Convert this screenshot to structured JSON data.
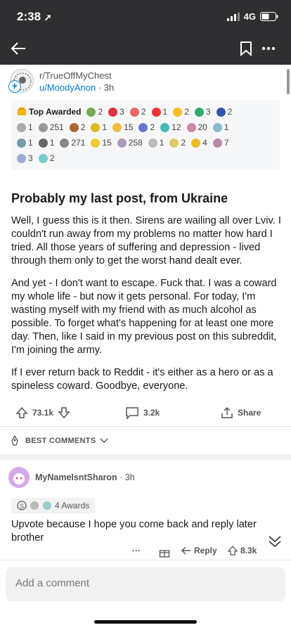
{
  "status": {
    "time": "2:38",
    "network": "4G"
  },
  "post": {
    "subreddit": "r/TrueOffMyChest",
    "author": "u/MoodyAnon",
    "time": "3h",
    "title": "Probably my last post, from Ukraine",
    "paragraphs": [
      "Well, I guess this is it then. Sirens are wailing all over Lviv. I couldn't run away from my problems no matter how hard I tried. All those years of suffering and depression - lived through them only to get the worst hand dealt ever.",
      "And yet - I don't want to escape. Fuck that. I was a coward my whole life - but now it gets personal. For today, I'm wasting myself with my friend with as much alcohol as possible. To forget what's happening for at least one more day. Then, like I said in my previous post on this subreddit, I'm joining the army.",
      "If I ever return back to Reddit - it's either as a hero or as a spineless coward. Goodbye, everyone."
    ],
    "upvotes": "73.1k",
    "comments": "3.2k",
    "share_label": "Share"
  },
  "awards": {
    "top_label": "Top Awarded",
    "rows": [
      [
        {
          "c": "#7a5",
          "n": "2"
        },
        {
          "c": "#d34",
          "n": "3"
        },
        {
          "c": "#e66",
          "n": "2"
        },
        {
          "c": "#e33",
          "n": "1"
        },
        {
          "c": "#fb2",
          "n": "2"
        },
        {
          "c": "#3a6",
          "n": "3"
        },
        {
          "c": "#35a",
          "n": "2"
        }
      ],
      [
        {
          "c": "#aaa",
          "n": "1"
        },
        {
          "c": "#999",
          "n": "251"
        },
        {
          "c": "#a63",
          "n": "2"
        },
        {
          "c": "#db2",
          "n": "1"
        },
        {
          "c": "#eb4",
          "n": "15"
        },
        {
          "c": "#67c",
          "n": "2"
        },
        {
          "c": "#4bb",
          "n": "12"
        },
        {
          "c": "#c8a",
          "n": "20"
        },
        {
          "c": "#8bc",
          "n": "1"
        }
      ],
      [
        {
          "c": "#79a",
          "n": "1"
        },
        {
          "c": "#666",
          "n": "1"
        },
        {
          "c": "#888",
          "n": "271"
        },
        {
          "c": "#ec3",
          "n": "15"
        },
        {
          "c": "#a9b",
          "n": "258"
        },
        {
          "c": "#bbb",
          "n": "1"
        },
        {
          "c": "#dc6",
          "n": "2"
        },
        {
          "c": "#eb2",
          "n": "4"
        },
        {
          "c": "#b8a",
          "n": "7"
        }
      ],
      [
        {
          "c": "#9ad",
          "n": "3"
        },
        {
          "c": "#7cc",
          "n": "2"
        }
      ]
    ]
  },
  "best_comments_label": "BEST COMMENTS",
  "comment": {
    "author": "MyNameIsntSharon",
    "time": "3h",
    "awards_label": "4 Awards",
    "body": "Upvote because I hope you come back and reply later brother",
    "reply_label": "Reply",
    "score": "8.3k"
  },
  "composer": {
    "placeholder": "Add a comment"
  }
}
